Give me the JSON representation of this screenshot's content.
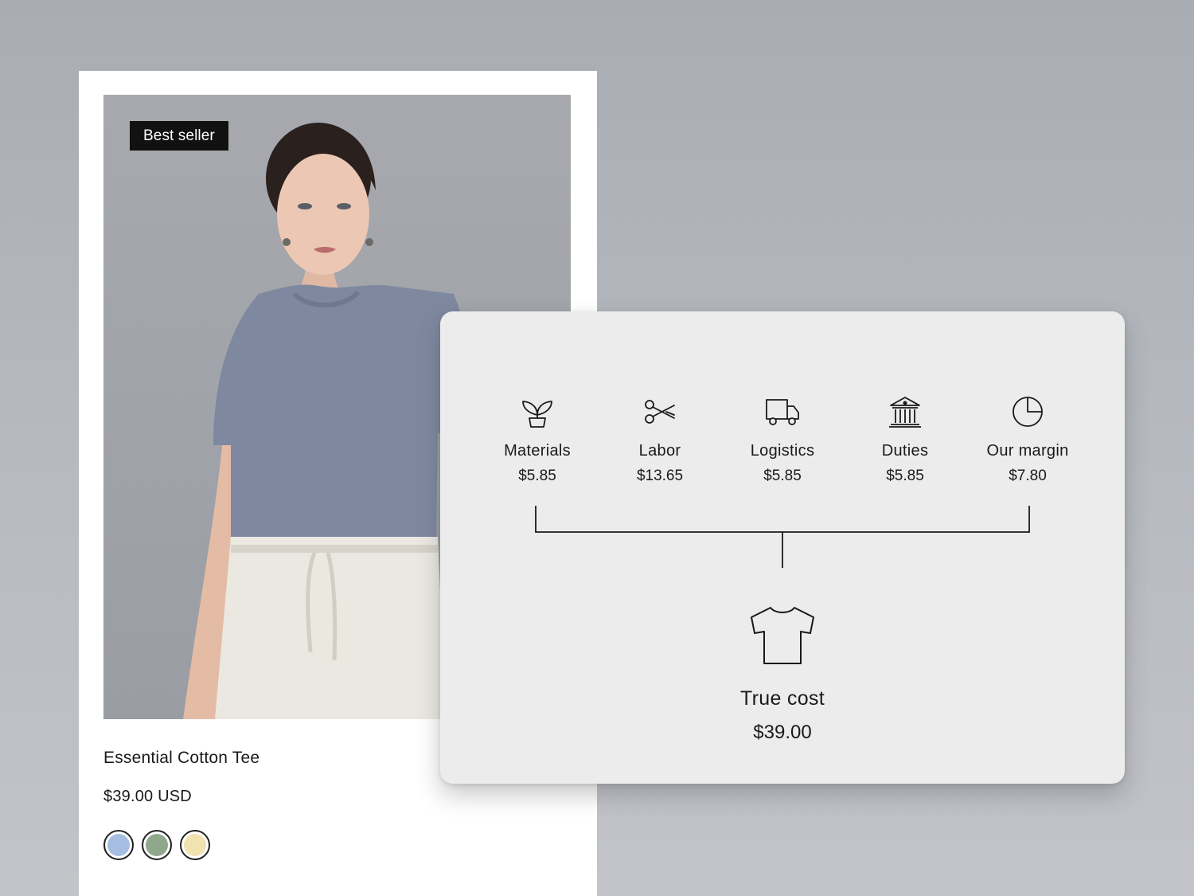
{
  "product": {
    "badge": "Best seller",
    "title": "Essential Cotton Tee",
    "price": "$39.00 USD",
    "swatches": [
      {
        "name": "blue",
        "color": "#a4bde0"
      },
      {
        "name": "green",
        "color": "#8fa88c"
      },
      {
        "name": "cream",
        "color": "#f1e2b0"
      }
    ]
  },
  "cost_breakdown": {
    "items": [
      {
        "label": "Materials",
        "value": "$5.85",
        "icon": "plant-icon"
      },
      {
        "label": "Labor",
        "value": "$13.65",
        "icon": "scissors-icon"
      },
      {
        "label": "Logistics",
        "value": "$5.85",
        "icon": "truck-icon"
      },
      {
        "label": "Duties",
        "value": "$5.85",
        "icon": "bank-icon"
      },
      {
        "label": "Our margin",
        "value": "$7.80",
        "icon": "pie-chart-icon"
      }
    ],
    "total": {
      "label": "True cost",
      "value": "$39.00",
      "icon": "tshirt-icon"
    }
  },
  "colors": {
    "badge_bg": "#111111",
    "panel_bg": "#edecec",
    "tee": "#7e889f",
    "pants": "#ebe8e1"
  }
}
